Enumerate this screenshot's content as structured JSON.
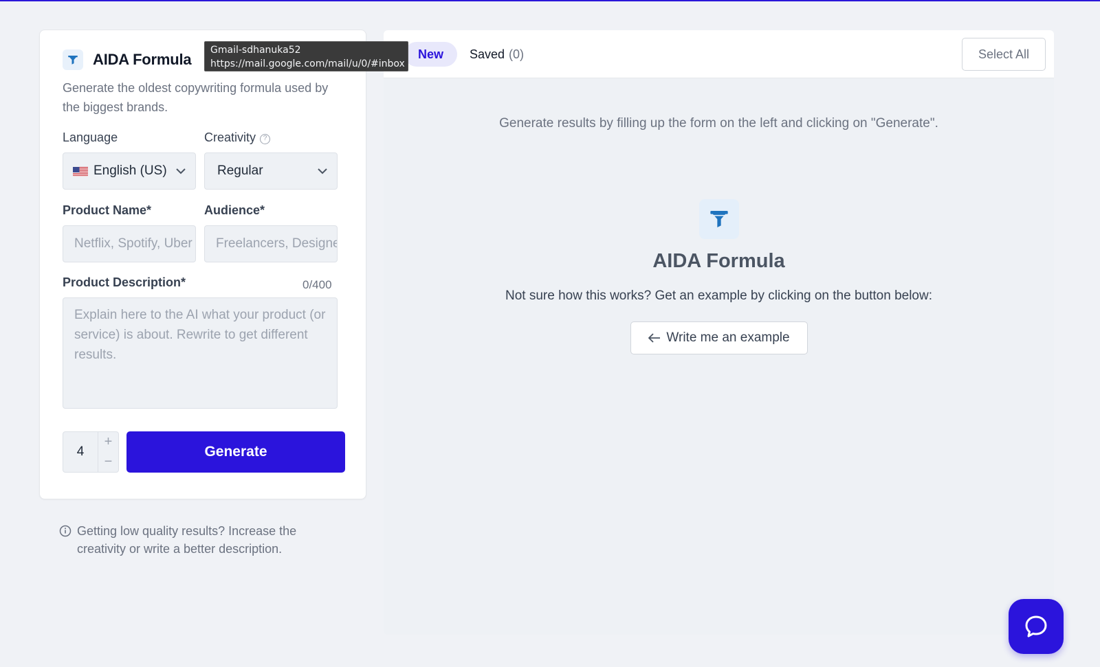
{
  "tool": {
    "title": "AIDA Formula",
    "description": "Generate the oldest copywriting formula used by the biggest brands."
  },
  "form": {
    "language_label": "Language",
    "language_value": "English (US)",
    "creativity_label": "Creativity",
    "creativity_value": "Regular",
    "product_name_label": "Product Name*",
    "product_name_placeholder": "Netflix, Spotify, Uber",
    "audience_label": "Audience*",
    "audience_placeholder": "Freelancers, Designers",
    "description_label": "Product Description*",
    "description_counter": "0/400",
    "description_placeholder": "Explain here to the AI what your product (or service) is about. Rewrite to get different results.",
    "quantity": "4",
    "plus": "+",
    "minus": "−",
    "generate_label": "Generate"
  },
  "hint": "Getting low quality results? Increase the creativity or write a better description.",
  "results": {
    "tab_new": "New",
    "tab_saved": "Saved",
    "saved_count": "(0)",
    "select_all": "Select All",
    "message": "Generate results by filling up the form on the left and clicking on \"Generate\".",
    "empty_title": "AIDA Formula",
    "empty_subtitle": "Not sure how this works? Get an example by clicking on the button below:",
    "example_button": "Write me an example"
  },
  "tooltip": {
    "line1": "Gmail-sdhanuka52",
    "line2": "https://mail.google.com/mail/u/0/#inbox"
  },
  "colors": {
    "primary": "#2b14dc",
    "icon_blue": "#1e73be",
    "background": "#f0f2f6"
  },
  "icons": [
    "funnel-icon",
    "help-circle-icon",
    "chevron-down-icon",
    "info-icon",
    "arrow-left-icon",
    "chat-bubble-icon",
    "us-flag-icon"
  ]
}
